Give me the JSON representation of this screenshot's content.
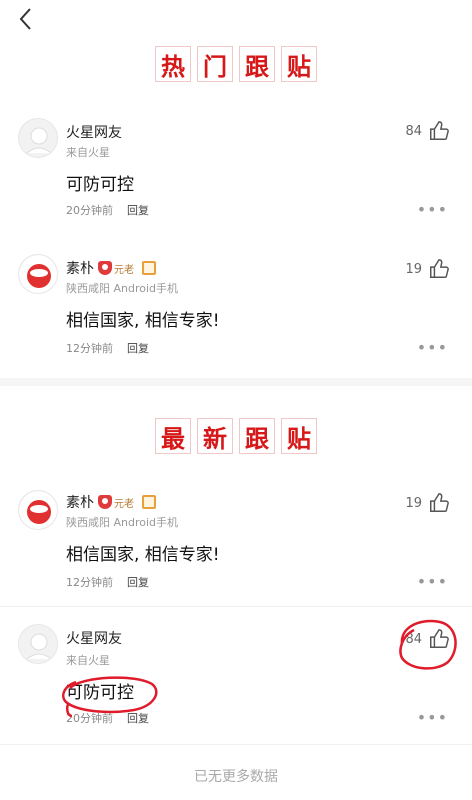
{
  "nav": {
    "back_icon": "chevron-left-icon"
  },
  "hot_section": {
    "chars": [
      "热",
      "门",
      "跟",
      "贴"
    ],
    "accent": "#d61818"
  },
  "new_section": {
    "chars": [
      "最",
      "新",
      "跟",
      "贴"
    ]
  },
  "hot_comments": [
    {
      "name": "火星网友",
      "sub": "来自火星",
      "text": "可防可控",
      "time": "20分钟前",
      "reply": "回复",
      "likes": "84",
      "badge": null
    },
    {
      "name": "素朴",
      "sub": "陕西咸阳 Android手机",
      "text": "相信国家, 相信专家!",
      "time": "12分钟前",
      "reply": "回复",
      "likes": "19",
      "badge": "元老"
    }
  ],
  "new_comments": [
    {
      "name": "素朴",
      "sub": "陕西咸阳 Android手机",
      "text": "相信国家, 相信专家!",
      "time": "12分钟前",
      "reply": "回复",
      "likes": "19",
      "badge": "元老"
    },
    {
      "name": "火星网友",
      "sub": "来自火星",
      "text": "可防可控",
      "time": "20分钟前",
      "reply": "回复",
      "likes": "84",
      "badge": null
    }
  ],
  "footer": "已无更多数据",
  "more_glyph": "•••"
}
